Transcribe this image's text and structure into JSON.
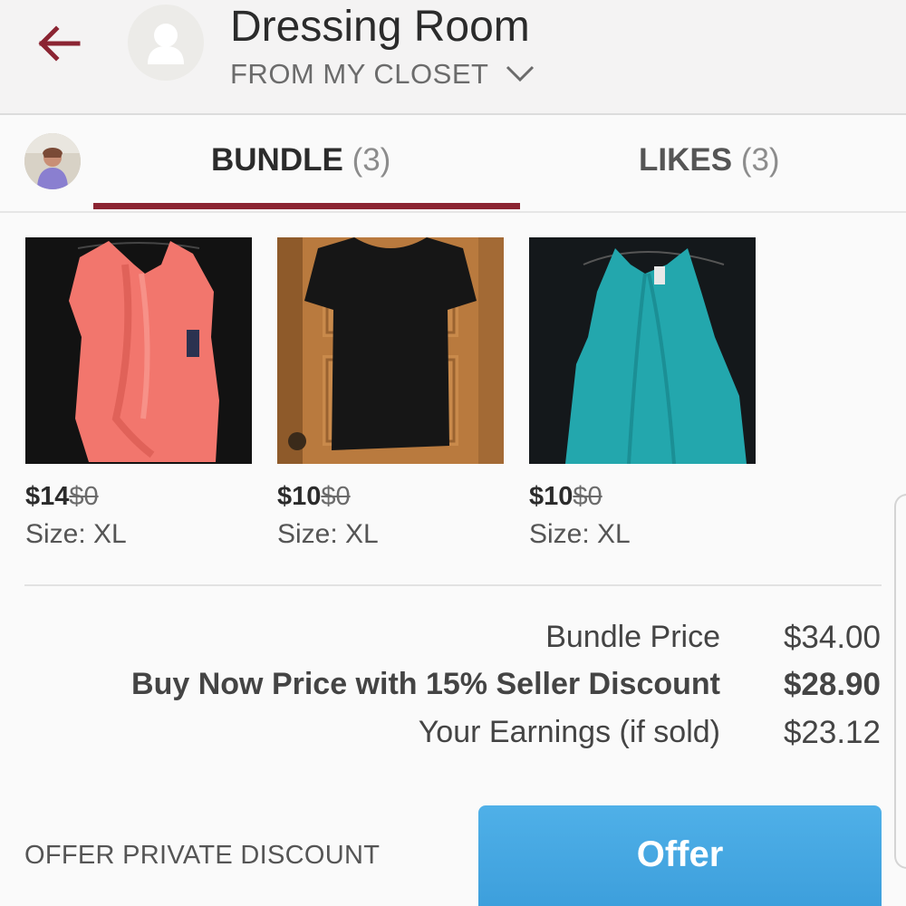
{
  "header": {
    "title": "Dressing Room",
    "subtitle": "FROM MY CLOSET",
    "accent_color": "#8b2432",
    "back_icon": "arrow-left-icon",
    "avatar_icon": "user-silhouette-icon",
    "dropdown_icon": "chevron-down-icon"
  },
  "tabs": [
    {
      "label": "BUNDLE",
      "count": "(3)",
      "active": true
    },
    {
      "label": "LIKES",
      "count": "(3)",
      "active": false
    }
  ],
  "items": [
    {
      "price": "$14",
      "original_price": "$0",
      "size": "Size: XL",
      "color": "coral"
    },
    {
      "price": "$10",
      "original_price": "$0",
      "size": "Size: XL",
      "color": "black"
    },
    {
      "price": "$10",
      "original_price": "$0",
      "size": "Size: XL",
      "color": "teal"
    }
  ],
  "summary": {
    "bundle_price_label": "Bundle Price",
    "bundle_price_value": "$34.00",
    "buy_now_label": "Buy Now Price with 15% Seller Discount",
    "buy_now_value": "$28.90",
    "earnings_label": "Your Earnings (if sold)",
    "earnings_value": "$23.12"
  },
  "actions": {
    "private_discount_label": "OFFER PRIVATE DISCOUNT",
    "offer_label": "Offer",
    "offer_color": "#4aaae3"
  }
}
